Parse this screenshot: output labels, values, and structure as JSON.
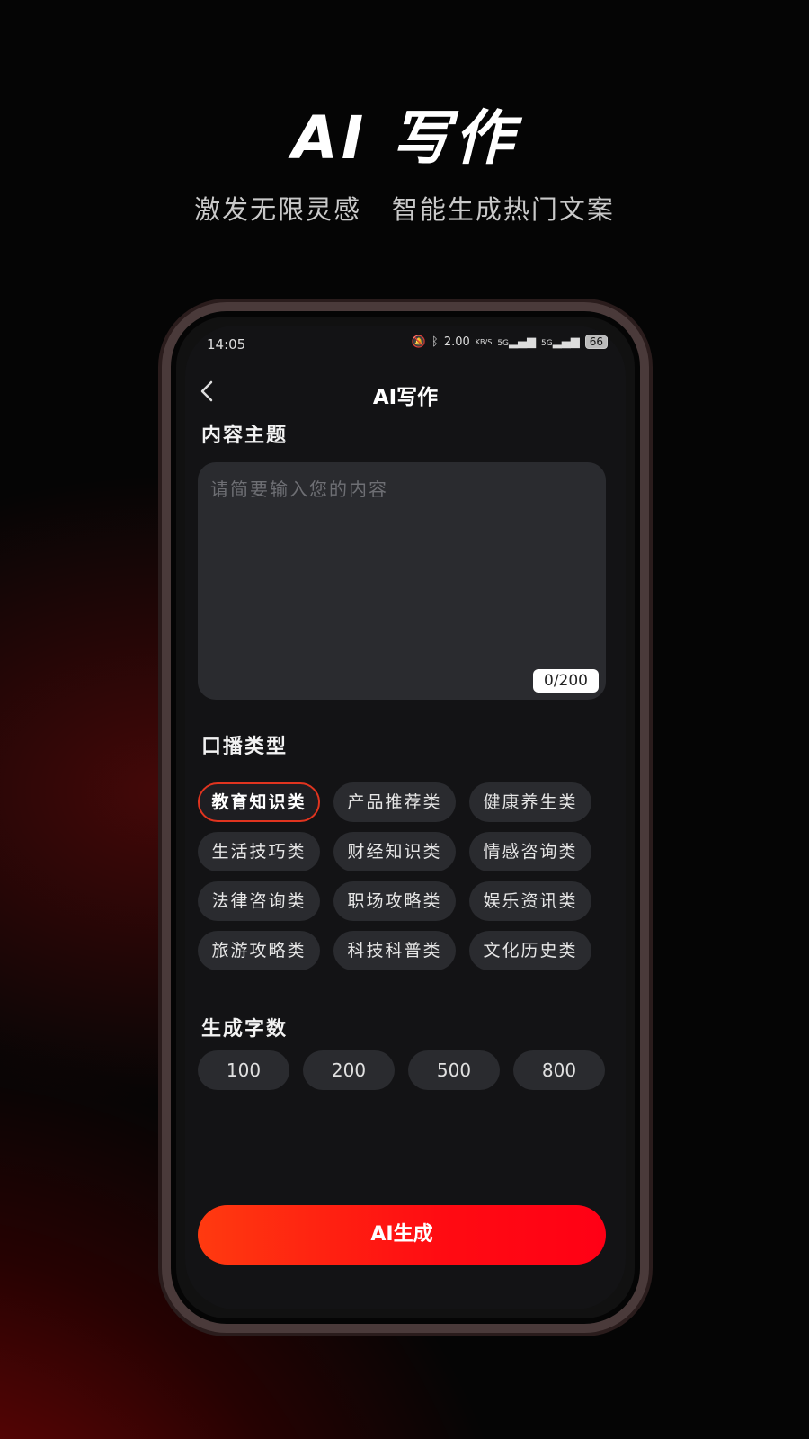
{
  "hero": {
    "title": "AI 写作",
    "subtitle": "激发无限灵感   智能生成热门文案"
  },
  "status_bar": {
    "time": "14:05",
    "network_speed": "2.00",
    "network_speed_unit": "KB/S",
    "signal_1": "5G",
    "signal_2": "5G",
    "battery": "66"
  },
  "nav": {
    "title": "AI写作",
    "back_icon": "chevron-left-icon"
  },
  "content_section": {
    "label": "内容主题",
    "placeholder": "请简要输入您的内容",
    "value": "",
    "counter": "0/200"
  },
  "type_section": {
    "label": "口播类型",
    "selected_index": 0,
    "options": [
      "教育知识类",
      "产品推荐类",
      "健康养生类",
      "生活技巧类",
      "财经知识类",
      "情感咨询类",
      "法律咨询类",
      "职场攻略类",
      "娱乐资讯类",
      "旅游攻略类",
      "科技科普类",
      "文化历史类"
    ]
  },
  "count_section": {
    "label": "生成字数",
    "options": [
      "100",
      "200",
      "500",
      "800"
    ]
  },
  "generate_button": {
    "label": "AI生成"
  },
  "colors": {
    "accent": "#ff1a12",
    "chip_bg": "#2a2b2f",
    "screen_bg": "#131315"
  }
}
